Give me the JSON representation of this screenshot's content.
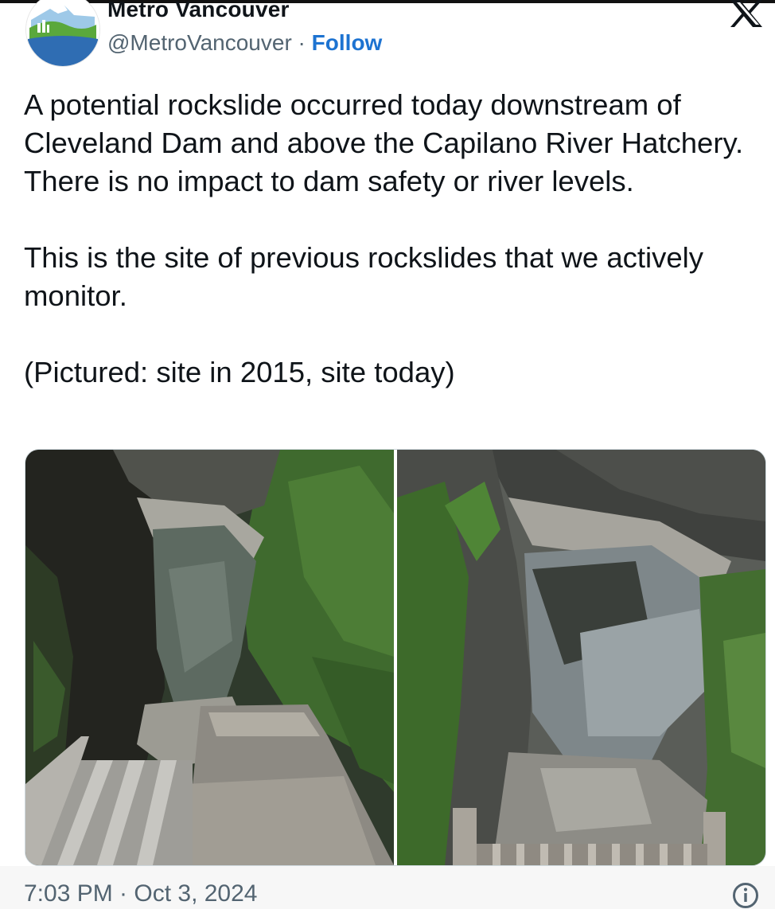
{
  "author": {
    "name": "Metro Vancouver",
    "handle": "@MetroVancouver",
    "separator": " · ",
    "follow_label": "Follow",
    "avatar_icon": "metro-vancouver-logo",
    "verified": false
  },
  "platform": {
    "logo_icon": "x-logo"
  },
  "tweet": {
    "text": "A potential rockslide occurred today downstream of Cleveland Dam and above the Capilano River Hatchery. There is no impact to dam safety or river levels.\n\nThis is the site of previous rockslides that we actively monitor.\n\n(Pictured: site in 2015, site today)"
  },
  "media": [
    {
      "subject": "Capilano canyon below Cleveland Dam spillway, 2015"
    },
    {
      "subject": "Capilano canyon below Cleveland Dam, today"
    }
  ],
  "footer": {
    "timestamp": "7:03 PM · Oct 3, 2024",
    "info_icon": "info-icon"
  },
  "colors": {
    "follow": "#1d73d1",
    "secondary_text": "#536471",
    "primary_text": "#0f1419"
  }
}
